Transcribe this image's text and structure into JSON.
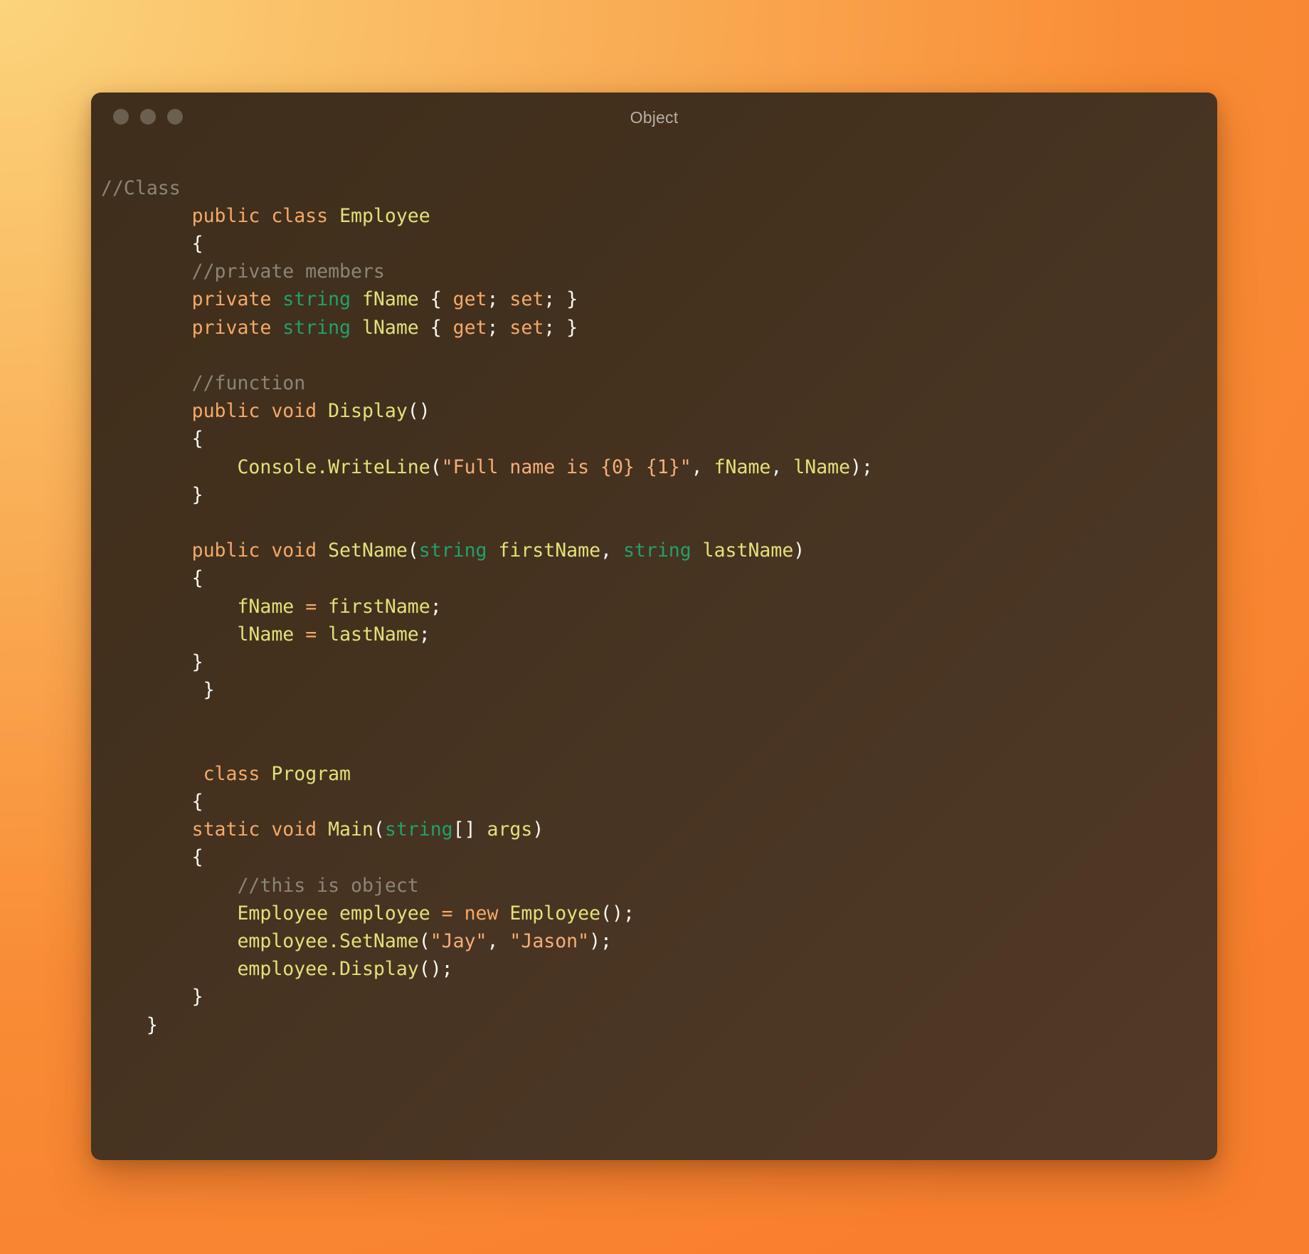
{
  "window": {
    "title": "Object",
    "traffic_lights": [
      {
        "name": "close-button",
        "color": "#6b5f4d"
      },
      {
        "name": "minimize-button",
        "color": "#6b5f4d"
      },
      {
        "name": "maximize-button",
        "color": "#6b5f4d"
      }
    ]
  },
  "theme": {
    "backdrop_start": "#f9cd70",
    "backdrop_end": "#f97f2e",
    "window_bg": "#43311e",
    "comment": "#8c8577",
    "keyword": "#f5a96a",
    "type": "#22a06b",
    "identifier": "#e4e07a",
    "string": "#f5ae7a",
    "punctuation": "#fbf9f2"
  },
  "code": {
    "language": "csharp",
    "plain_text": "//Class\n        public class Employee\n        {\n        //private members\n        private string fName { get; set; }\n        private string lName { get; set; }\n\n        //function\n        public void Display()\n        {\n            Console.WriteLine(\"Full name is {0} {1}\", fName, lName);\n        }\n\n        public void SetName(string firstName, string lastName)\n        {\n            fName = firstName;\n            lName = lastName;\n        }\n        }\n\n\n        class Program\n        {\n        static void Main(string[] args)\n        {\n            //this is object\n            Employee employee = new Employee();\n            employee.SetName(\"Jay\", \"Jason\");\n            employee.Display();\n        }\n    }",
    "lines": [
      [
        {
          "t": "comment",
          "s": "//Class"
        }
      ],
      [
        {
          "t": "plain",
          "s": "        "
        },
        {
          "t": "keyword",
          "s": "public class "
        },
        {
          "t": "ident",
          "s": "Employee"
        }
      ],
      [
        {
          "t": "plain",
          "s": "        "
        },
        {
          "t": "punct",
          "s": "{"
        }
      ],
      [
        {
          "t": "plain",
          "s": "        "
        },
        {
          "t": "comment",
          "s": "//private members"
        }
      ],
      [
        {
          "t": "plain",
          "s": "        "
        },
        {
          "t": "keyword",
          "s": "private "
        },
        {
          "t": "type",
          "s": "string"
        },
        {
          "t": "ident",
          "s": " fName "
        },
        {
          "t": "punct",
          "s": "{ "
        },
        {
          "t": "keyword",
          "s": "get"
        },
        {
          "t": "punct",
          "s": "; "
        },
        {
          "t": "keyword",
          "s": "set"
        },
        {
          "t": "punct",
          "s": "; }"
        }
      ],
      [
        {
          "t": "plain",
          "s": "        "
        },
        {
          "t": "keyword",
          "s": "private "
        },
        {
          "t": "type",
          "s": "string"
        },
        {
          "t": "ident",
          "s": " lName "
        },
        {
          "t": "punct",
          "s": "{ "
        },
        {
          "t": "keyword",
          "s": "get"
        },
        {
          "t": "punct",
          "s": "; "
        },
        {
          "t": "keyword",
          "s": "set"
        },
        {
          "t": "punct",
          "s": "; }"
        }
      ],
      [
        {
          "t": "plain",
          "s": ""
        }
      ],
      [
        {
          "t": "plain",
          "s": "        "
        },
        {
          "t": "comment",
          "s": "//function"
        }
      ],
      [
        {
          "t": "plain",
          "s": "        "
        },
        {
          "t": "keyword",
          "s": "public void "
        },
        {
          "t": "ident",
          "s": "Display"
        },
        {
          "t": "punct",
          "s": "()"
        }
      ],
      [
        {
          "t": "plain",
          "s": "        "
        },
        {
          "t": "punct",
          "s": "{"
        }
      ],
      [
        {
          "t": "plain",
          "s": "            "
        },
        {
          "t": "ident",
          "s": "Console.WriteLine"
        },
        {
          "t": "punct",
          "s": "("
        },
        {
          "t": "string",
          "s": "\"Full name is {0} {1}\""
        },
        {
          "t": "punct",
          "s": ", "
        },
        {
          "t": "ident",
          "s": "fName"
        },
        {
          "t": "punct",
          "s": ", "
        },
        {
          "t": "ident",
          "s": "lName"
        },
        {
          "t": "punct",
          "s": ");"
        }
      ],
      [
        {
          "t": "plain",
          "s": "        "
        },
        {
          "t": "punct",
          "s": "}"
        }
      ],
      [
        {
          "t": "plain",
          "s": ""
        }
      ],
      [
        {
          "t": "plain",
          "s": "        "
        },
        {
          "t": "keyword",
          "s": "public void "
        },
        {
          "t": "ident",
          "s": "SetName"
        },
        {
          "t": "punct",
          "s": "("
        },
        {
          "t": "type",
          "s": "string"
        },
        {
          "t": "ident",
          "s": " firstName"
        },
        {
          "t": "punct",
          "s": ", "
        },
        {
          "t": "type",
          "s": "string"
        },
        {
          "t": "ident",
          "s": " lastName"
        },
        {
          "t": "punct",
          "s": ")"
        }
      ],
      [
        {
          "t": "plain",
          "s": "        "
        },
        {
          "t": "punct",
          "s": "{"
        }
      ],
      [
        {
          "t": "plain",
          "s": "            "
        },
        {
          "t": "ident",
          "s": "fName "
        },
        {
          "t": "op",
          "s": "="
        },
        {
          "t": "ident",
          "s": " firstName"
        },
        {
          "t": "punct",
          "s": ";"
        }
      ],
      [
        {
          "t": "plain",
          "s": "            "
        },
        {
          "t": "ident",
          "s": "lName "
        },
        {
          "t": "op",
          "s": "="
        },
        {
          "t": "ident",
          "s": " lastName"
        },
        {
          "t": "punct",
          "s": ";"
        }
      ],
      [
        {
          "t": "plain",
          "s": "        "
        },
        {
          "t": "punct",
          "s": "}"
        }
      ],
      [
        {
          "t": "plain",
          "s": "         "
        },
        {
          "t": "punct",
          "s": "}"
        }
      ],
      [
        {
          "t": "plain",
          "s": ""
        }
      ],
      [
        {
          "t": "plain",
          "s": ""
        }
      ],
      [
        {
          "t": "plain",
          "s": "         "
        },
        {
          "t": "keyword",
          "s": "class "
        },
        {
          "t": "ident",
          "s": "Program"
        }
      ],
      [
        {
          "t": "plain",
          "s": "        "
        },
        {
          "t": "punct",
          "s": "{"
        }
      ],
      [
        {
          "t": "plain",
          "s": "        "
        },
        {
          "t": "keyword",
          "s": "static void "
        },
        {
          "t": "ident",
          "s": "Main"
        },
        {
          "t": "punct",
          "s": "("
        },
        {
          "t": "type",
          "s": "string"
        },
        {
          "t": "punct",
          "s": "[]"
        },
        {
          "t": "ident",
          "s": " args"
        },
        {
          "t": "punct",
          "s": ")"
        }
      ],
      [
        {
          "t": "plain",
          "s": "        "
        },
        {
          "t": "punct",
          "s": "{"
        }
      ],
      [
        {
          "t": "plain",
          "s": "            "
        },
        {
          "t": "comment",
          "s": "//this is object"
        }
      ],
      [
        {
          "t": "plain",
          "s": "            "
        },
        {
          "t": "ident",
          "s": "Employee employee "
        },
        {
          "t": "op",
          "s": "="
        },
        {
          "t": "keyword",
          "s": " new "
        },
        {
          "t": "ident",
          "s": "Employee"
        },
        {
          "t": "punct",
          "s": "();"
        }
      ],
      [
        {
          "t": "plain",
          "s": "            "
        },
        {
          "t": "ident",
          "s": "employee.SetName"
        },
        {
          "t": "punct",
          "s": "("
        },
        {
          "t": "string",
          "s": "\"Jay\""
        },
        {
          "t": "punct",
          "s": ", "
        },
        {
          "t": "string",
          "s": "\"Jason\""
        },
        {
          "t": "punct",
          "s": ");"
        }
      ],
      [
        {
          "t": "plain",
          "s": "            "
        },
        {
          "t": "ident",
          "s": "employee.Display"
        },
        {
          "t": "punct",
          "s": "();"
        }
      ],
      [
        {
          "t": "plain",
          "s": "        "
        },
        {
          "t": "punct",
          "s": "}"
        }
      ],
      [
        {
          "t": "plain",
          "s": "    "
        },
        {
          "t": "punct",
          "s": "}"
        }
      ]
    ]
  }
}
